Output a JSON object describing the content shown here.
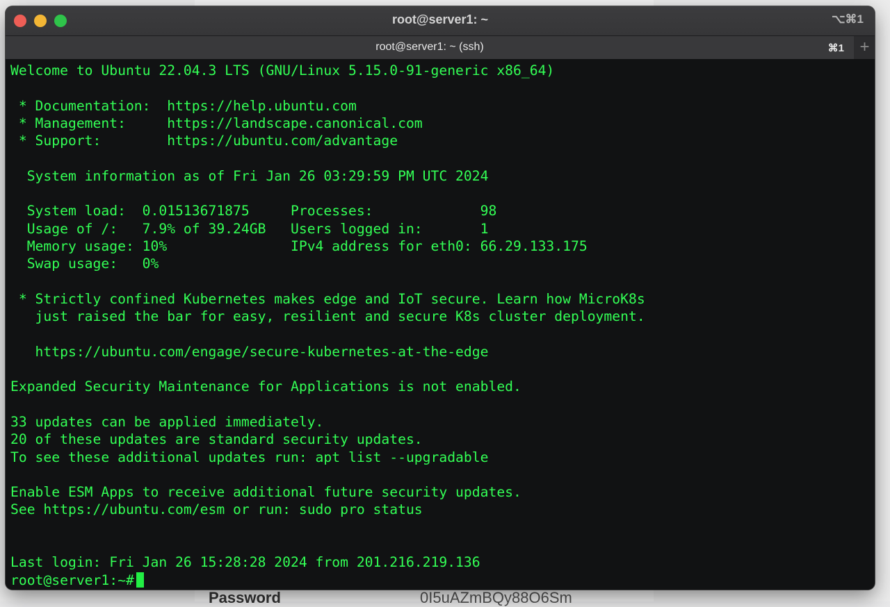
{
  "window": {
    "title": "root@server1: ~",
    "shortcut": "⌥⌘1"
  },
  "tab": {
    "label": "root@server1: ~ (ssh)",
    "shortcut": "⌘1",
    "new_tab_symbol": "+"
  },
  "terminal": {
    "lines": [
      "Welcome to Ubuntu 22.04.3 LTS (GNU/Linux 5.15.0-91-generic x86_64)",
      "",
      " * Documentation:  https://help.ubuntu.com",
      " * Management:     https://landscape.canonical.com",
      " * Support:        https://ubuntu.com/advantage",
      "",
      "  System information as of Fri Jan 26 03:29:59 PM UTC 2024",
      "",
      "  System load:  0.01513671875     Processes:             98",
      "  Usage of /:   7.9% of 39.24GB   Users logged in:       1",
      "  Memory usage: 10%               IPv4 address for eth0: 66.29.133.175",
      "  Swap usage:   0%",
      "",
      " * Strictly confined Kubernetes makes edge and IoT secure. Learn how MicroK8s",
      "   just raised the bar for easy, resilient and secure K8s cluster deployment.",
      "",
      "   https://ubuntu.com/engage/secure-kubernetes-at-the-edge",
      "",
      "Expanded Security Maintenance for Applications is not enabled.",
      "",
      "33 updates can be applied immediately.",
      "20 of these updates are standard security updates.",
      "To see these additional updates run: apt list --upgradable",
      "",
      "Enable ESM Apps to receive additional future security updates.",
      "See https://ubuntu.com/esm or run: sudo pro status",
      "",
      "",
      "Last login: Fri Jan 26 15:28:28 2024 from 201.216.219.136"
    ],
    "prompt": "root@server1:~#",
    "text_color": "#33ff55",
    "background_color": "#111213"
  },
  "background_page": {
    "footer_label": "Password",
    "footer_value": "0I5uAZmBQy88O6Sm"
  }
}
